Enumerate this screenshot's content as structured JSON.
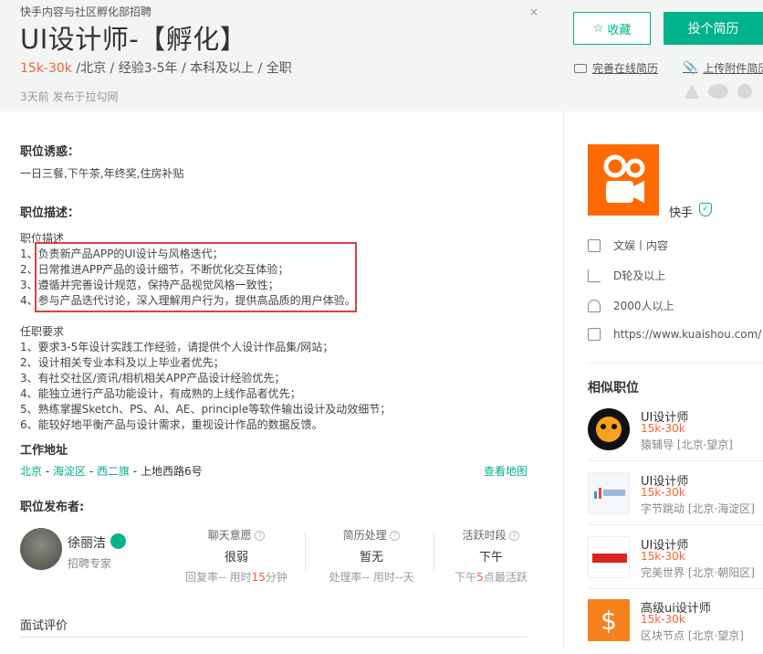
{
  "header": {
    "department": "快手内容与社区孵化部招聘",
    "title": "UI设计师-【孵化】",
    "salary": "15k-30k",
    "requirements": " /北京 / 经验3-5年 / 本科及以上 / 全职",
    "posted": "3天前  发布于拉勾网",
    "close_glyph": "×",
    "favorite_label": "收藏",
    "apply_label": "投个简历",
    "online_resume": "完善在线简历",
    "upload_resume": "上传附件简历"
  },
  "perks": {
    "title": "职位诱惑：",
    "text": "一日三餐,下午茶,年终奖,住房补贴"
  },
  "description": {
    "title": "职位描述：",
    "subtitle": "职位描述",
    "duties": [
      "1、负责新产品APP的UI设计与风格迭代；",
      "2、日常推进APP产品的设计细节，不断优化交互体验；",
      "3、遵循并完善设计规范，保持产品视觉风格一致性；",
      "4、参与产品迭代讨论，深入理解用户行为，提供高品质的用户体验。"
    ],
    "req_title": "任职要求",
    "requirements": [
      "1、要求3-5年设计实践工作经验，请提供个人设计作品集/网站；",
      "2、设计相关专业本科及以上毕业者优先；",
      "3、有社交社区/资讯/相机相关APP产品设计经验优先；",
      "4、能独立进行产品功能设计，有成熟的上线作品者优先；",
      "5、熟练掌握Sketch、PS、AI、AE、principle等软件输出设计及动效细节；",
      "6、能较好地平衡产品与设计需求，重视设计作品的数据反馈。"
    ]
  },
  "address": {
    "title": "工作地址",
    "city": "北京",
    "district": "海淀区",
    "area": "西二旗",
    "street": "上地西路6号",
    "sep": " - ",
    "map_link": "查看地图"
  },
  "publisher": {
    "title": "职位发布者:",
    "name": "徐丽洁",
    "role": "招聘专家",
    "stats": [
      {
        "label": "聊天意愿",
        "value": "很弱",
        "sub_a": "回复率--   用时",
        "sub_hl": "15",
        "sub_b": "分钟"
      },
      {
        "label": "简历处理",
        "value": "暂无",
        "sub_a": "处理率--   用时--天",
        "sub_hl": "",
        "sub_b": ""
      },
      {
        "label": "活跃时段",
        "value": "下午",
        "sub_a": "下午",
        "sub_hl": "5",
        "sub_b": "点最活跃"
      }
    ],
    "q_glyph": "?"
  },
  "interview": {
    "title": "面试评价"
  },
  "company": {
    "name": "快手",
    "verified_glyph": "✓",
    "field": "文娱丨内容",
    "stage": "D轮及以上",
    "size": "2000人以上",
    "website": "https://www.kuaishou.com/"
  },
  "similar": {
    "title": "相似职位",
    "items": [
      {
        "title": "UI设计师",
        "salary": "15k-30k",
        "company": "猿辅导 [北京·望京]"
      },
      {
        "title": "UI设计师",
        "salary": "15k-30k",
        "company": "字节跳动 [北京·海淀区]"
      },
      {
        "title": "UI设计师",
        "salary": "15k-30k",
        "company": "完美世界 [北京·朝阳区]"
      },
      {
        "title": "高级ui设计师",
        "salary": "15k-30k",
        "company": "区块节点 [北京·望京]"
      }
    ]
  },
  "colors": {
    "accent": "#00b38a",
    "salary": "#fd5f39",
    "highlight_box": "#d9423f"
  }
}
